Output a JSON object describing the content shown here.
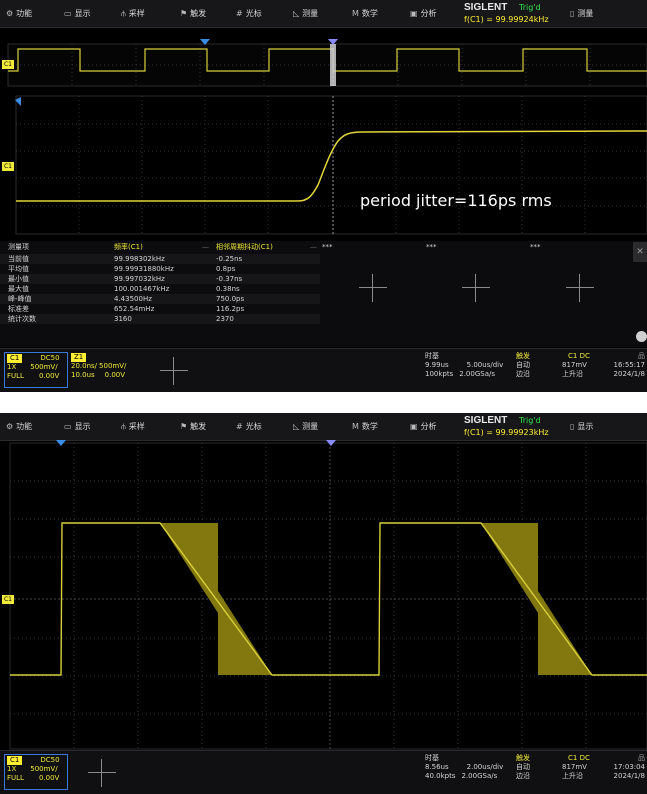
{
  "top": {
    "menu": [
      "功能",
      "显示",
      "采样",
      "触发",
      "光标",
      "测量",
      "数学",
      "分析"
    ],
    "menu_icons": [
      "gear-icon",
      "display-icon",
      "sample-icon",
      "trigger-flag-icon",
      "cursor-icon",
      "measure-icon",
      "math-icon",
      "analysis-icon"
    ],
    "brand": "SIGLENT",
    "trig_status": "Trig'd",
    "freq_readout": "f(C1) = 99.99924kHz",
    "right_label": "测量",
    "annotation": "period jitter=116ps rms",
    "channel_marker": "C1",
    "measure": {
      "head_item": "测量项",
      "col1_title": "频率(C1)",
      "col2_title": "相邻周期抖动(C1)",
      "empty_titles": [
        "***",
        "***",
        "***"
      ],
      "rows": [
        {
          "label": "当前值",
          "v1": "99.998302kHz",
          "v2": "-0.25ns"
        },
        {
          "label": "平均值",
          "v1": "99.99931880kHz",
          "v2": "0.8ps"
        },
        {
          "label": "最小值",
          "v1": "99.997032kHz",
          "v2": "-0.37ns"
        },
        {
          "label": "最大值",
          "v1": "100.001467kHz",
          "v2": "0.38ns"
        },
        {
          "label": "峰-峰值",
          "v1": "4.43500Hz",
          "v2": "750.0ps"
        },
        {
          "label": "标准差",
          "v1": "652.54mHz",
          "v2": "116.2ps"
        },
        {
          "label": "统计次数",
          "v1": "3160",
          "v2": "2370"
        }
      ]
    },
    "status": {
      "c1_tag": "C1",
      "c1_coupling": "DC50",
      "c1_probe": "1X",
      "c1_scale": "500mV/",
      "c1_bw": "FULL",
      "c1_offset": "0.00V",
      "z1_tag": "Z1",
      "z1_time": "20.0ns/",
      "z1_scale": "500mV/",
      "z1_pos": "10.0us",
      "z1_offset": "0.00V",
      "tb_title": "时基",
      "tb_delay": "9.99us",
      "tb_scale": "5.00us/div",
      "tb_points": "100kpts",
      "tb_rate": "2.00GSa/s",
      "trig_title": "触发",
      "trig_src": "C1 DC",
      "trig_mode": "自动",
      "trig_level": "817mV",
      "trig_type": "边沿",
      "trig_slope": "上升沿",
      "time": "16:55:17",
      "date": "2024/1/8"
    }
  },
  "bottom": {
    "menu": [
      "功能",
      "显示",
      "采样",
      "触发",
      "光标",
      "测量",
      "数学",
      "分析"
    ],
    "brand": "SIGLENT",
    "trig_status": "Trig'd",
    "freq_readout": "f(C1) = 99.99923kHz",
    "right_label": "显示",
    "channel_marker": "C1",
    "status": {
      "c1_tag": "C1",
      "c1_coupling": "DC50",
      "c1_probe": "1X",
      "c1_scale": "500mV/",
      "c1_bw": "FULL",
      "c1_offset": "0.00V",
      "tb_title": "时基",
      "tb_delay": "8.56us",
      "tb_scale": "2.00us/div",
      "tb_points": "40.0kpts",
      "tb_rate": "2.00GSa/s",
      "trig_title": "触发",
      "trig_src": "C1 DC",
      "trig_mode": "自动",
      "trig_level": "817mV",
      "trig_type": "边沿",
      "trig_slope": "上升沿",
      "time": "17:03:04",
      "date": "2024/1/8"
    }
  },
  "colors": {
    "trace": "#f2ea3a",
    "trigger_green": "#2ee84a",
    "grid": "#3a3a3a",
    "marker_blue": "#3a8ce8"
  }
}
